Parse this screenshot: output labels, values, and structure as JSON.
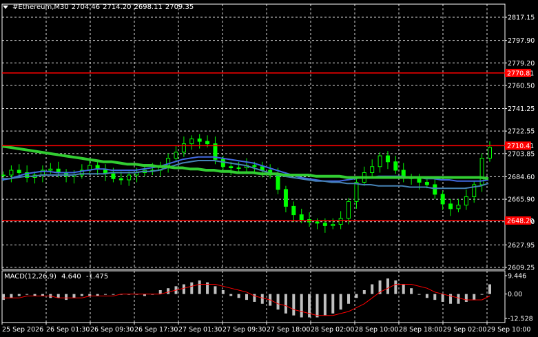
{
  "header": {
    "symbol": "#Ethereum,M30",
    "open": "2704.46",
    "high": "2714.20",
    "low": "2698.11",
    "close": "2709.35"
  },
  "macd_header": {
    "label": "MACD(12,26,9)",
    "main": "4.640",
    "signal": "-1.475"
  },
  "colors": {
    "background": "#000000",
    "grid": "#ffffff",
    "candles": "#00ff00",
    "ma_fast": "#4169e1",
    "ma_mid": "#4682b4",
    "ma_slow": "#32cd32",
    "level_lines": "#ff0000",
    "macd_hist": "#c0c0c0",
    "macd_signal": "#ff0000"
  },
  "chart_data": [
    {
      "type": "line",
      "title": "#Ethereum,M30",
      "ylim": [
        2609.25,
        2817.15
      ],
      "y_ticks": [
        "2817.15",
        "2797.90",
        "2779.20",
        "2760.50",
        "2741.25",
        "2722.55",
        "2703.85",
        "2684.60",
        "2665.90",
        "2647.20",
        "2627.95",
        "2609.25"
      ],
      "x_ticks": [
        "25 Sep 2026",
        "26 Sep 01:30",
        "26 Sep 09:30",
        "26 Sep 17:30",
        "27 Sep 01:30",
        "27 Sep 09:30",
        "27 Sep 18:00",
        "28 Sep 02:00",
        "28 Sep 10:00",
        "28 Sep 18:00",
        "29 Sep 02:00",
        "29 Sep 10:00"
      ],
      "levels": [
        {
          "value": 2770.81,
          "label": "2770.81"
        },
        {
          "value": 2710.41,
          "label": "2710.41"
        },
        {
          "value": 2648.2,
          "label": "2648.20"
        }
      ],
      "close_series": [
        2686,
        2690,
        2688,
        2684,
        2686,
        2690,
        2691,
        2688,
        2685,
        2686,
        2690,
        2694,
        2691,
        2687,
        2683,
        2682,
        2686,
        2688,
        2690,
        2690,
        2694,
        2700,
        2705,
        2712,
        2716,
        2714,
        2712,
        2699,
        2693,
        2692,
        2692,
        2694,
        2693,
        2690,
        2686,
        2674,
        2660,
        2653,
        2649,
        2647,
        2646,
        2644,
        2645,
        2650,
        2664,
        2680,
        2688,
        2693,
        2702,
        2697,
        2690,
        2684,
        2683,
        2680,
        2678,
        2670,
        2662,
        2658,
        2661,
        2668,
        2678,
        2700,
        2709
      ],
      "series": [
        {
          "values": [
            2682,
            2683,
            2685,
            2687,
            2688,
            2689,
            2689,
            2688,
            2688,
            2688,
            2689,
            2690,
            2691,
            2691,
            2690,
            2690,
            2690,
            2690,
            2691,
            2692,
            2693,
            2695,
            2697,
            2699,
            2700,
            2701,
            2701,
            2701,
            2700,
            2699,
            2698,
            2697,
            2696,
            2694,
            2692,
            2690,
            2688,
            2686,
            2684,
            2683,
            2682,
            2681,
            2681,
            2681,
            2682,
            2683,
            2684,
            2684,
            2685,
            2685,
            2685,
            2685,
            2684,
            2684,
            2683,
            2683,
            2682,
            2682,
            2681,
            2681,
            2681,
            2681,
            2682
          ]
        },
        {
          "values": [
            2683,
            2683,
            2684,
            2685,
            2685,
            2686,
            2686,
            2686,
            2686,
            2686,
            2687,
            2687,
            2687,
            2687,
            2688,
            2688,
            2688,
            2688,
            2689,
            2689,
            2690,
            2692,
            2694,
            2696,
            2697,
            2698,
            2698,
            2698,
            2697,
            2696,
            2695,
            2694,
            2692,
            2690,
            2688,
            2686,
            2685,
            2684,
            2683,
            2682,
            2681,
            2681,
            2680,
            2680,
            2679,
            2679,
            2678,
            2678,
            2677,
            2677,
            2677,
            2677,
            2676,
            2676,
            2676,
            2675,
            2675,
            2675,
            2675,
            2675,
            2676,
            2677,
            2679
          ]
        },
        {
          "values": [
            2710,
            2709,
            2708,
            2707,
            2706,
            2705,
            2704,
            2703,
            2702,
            2701,
            2700,
            2699,
            2698,
            2697,
            2697,
            2696,
            2695,
            2695,
            2694,
            2694,
            2693,
            2693,
            2692,
            2692,
            2691,
            2691,
            2690,
            2690,
            2689,
            2689,
            2688,
            2688,
            2688,
            2687,
            2687,
            2687,
            2686,
            2686,
            2686,
            2686,
            2685,
            2685,
            2685,
            2685,
            2684,
            2684,
            2684,
            2684,
            2684,
            2684,
            2684,
            2684,
            2684,
            2684,
            2684,
            2684,
            2684,
            2684,
            2684,
            2684,
            2684,
            2684,
            2683
          ]
        }
      ]
    },
    {
      "type": "bar",
      "title": "MACD(12,26,9)",
      "ylim": [
        -12.528,
        9.446
      ],
      "y_ticks": [
        "9.446",
        "0.00",
        "-12.528"
      ],
      "histogram": [
        -3,
        -2,
        -1,
        0,
        -1,
        -1,
        -2,
        -2,
        -3,
        -2,
        -1,
        -1,
        -1,
        0,
        0,
        0,
        0,
        0,
        -1,
        0,
        2,
        3,
        4,
        5,
        6,
        7,
        6,
        4,
        2,
        -1,
        -2,
        -3,
        -4,
        -5,
        -6,
        -8,
        -10,
        -11,
        -12,
        -12,
        -12,
        -11,
        -10,
        -8,
        -5,
        -2,
        2,
        5,
        7,
        8,
        7,
        5,
        3,
        0,
        -2,
        -3,
        -4,
        -5,
        -5,
        -4,
        -3,
        0,
        5
      ],
      "signal": [
        -2,
        -2,
        -2,
        -1,
        -1,
        -1,
        -1,
        -2,
        -2,
        -2,
        -2,
        -1,
        -1,
        -1,
        -1,
        0,
        0,
        0,
        0,
        0,
        0,
        1,
        2,
        3,
        4,
        5,
        5,
        5,
        4,
        3,
        2,
        1,
        -1,
        -2,
        -3,
        -5,
        -6,
        -8,
        -9,
        -10,
        -11,
        -11,
        -11,
        -10,
        -9,
        -7,
        -5,
        -2,
        1,
        3,
        5,
        5,
        5,
        4,
        3,
        1,
        0,
        -1,
        -2,
        -3,
        -3,
        -3,
        -1
      ]
    }
  ]
}
